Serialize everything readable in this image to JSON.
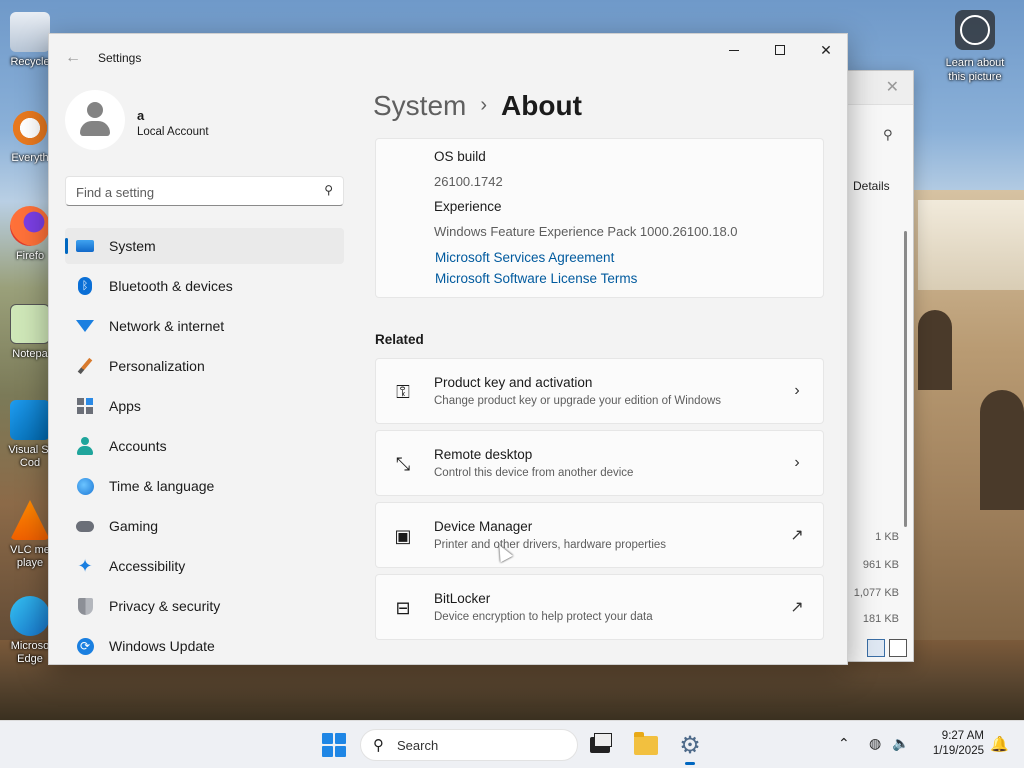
{
  "desktop": {
    "icons": [
      {
        "label": "Recycle"
      },
      {
        "label": "Everyth"
      },
      {
        "label": "Firefo"
      },
      {
        "label": "Notepa"
      },
      {
        "label": "Visual St Cod"
      },
      {
        "label": "VLC me playe"
      },
      {
        "label": "Microso Edge"
      }
    ],
    "learn_label": "Learn about this picture"
  },
  "background_window": {
    "details_label": "Details",
    "sizes": [
      "1 KB",
      "961 KB",
      "1,077 KB",
      "181 KB"
    ]
  },
  "settings": {
    "title": "Settings",
    "user": {
      "name": "a",
      "account_type": "Local Account"
    },
    "search_placeholder": "Find a setting",
    "nav": [
      {
        "label": "System",
        "icon": "monitor-icon",
        "active": true
      },
      {
        "label": "Bluetooth & devices",
        "icon": "bluetooth-icon"
      },
      {
        "label": "Network & internet",
        "icon": "wifi-icon"
      },
      {
        "label": "Personalization",
        "icon": "brush-icon"
      },
      {
        "label": "Apps",
        "icon": "apps-icon"
      },
      {
        "label": "Accounts",
        "icon": "person-icon"
      },
      {
        "label": "Time & language",
        "icon": "globe-clock-icon"
      },
      {
        "label": "Gaming",
        "icon": "gamepad-icon"
      },
      {
        "label": "Accessibility",
        "icon": "accessibility-icon"
      },
      {
        "label": "Privacy & security",
        "icon": "shield-icon"
      },
      {
        "label": "Windows Update",
        "icon": "update-icon"
      }
    ],
    "breadcrumb": {
      "parent": "System",
      "separator": "›",
      "current": "About"
    },
    "specs": {
      "os_build_label": "OS build",
      "os_build_value": "26100.1742",
      "experience_label": "Experience",
      "experience_value": "Windows Feature Experience Pack 1000.26100.18.0",
      "link1": "Microsoft Services Agreement",
      "link2": "Microsoft Software License Terms"
    },
    "related": {
      "title": "Related",
      "items": [
        {
          "title": "Product key and activation",
          "subtitle": "Change product key or upgrade your edition of Windows",
          "icon": "key-icon",
          "action": "chevron"
        },
        {
          "title": "Remote desktop",
          "subtitle": "Control this device from another device",
          "icon": "remote-desktop-icon",
          "action": "chevron"
        },
        {
          "title": "Device Manager",
          "subtitle": "Printer and other drivers, hardware properties",
          "icon": "device-manager-icon",
          "action": "external"
        },
        {
          "title": "BitLocker",
          "subtitle": "Device encryption to help protect your data",
          "icon": "bitlocker-icon",
          "action": "external"
        }
      ]
    }
  },
  "taskbar": {
    "search_label": "Search",
    "time": "9:27 AM",
    "date": "1/19/2025"
  },
  "colors": {
    "accent": "#0067c0",
    "link": "#005a9e",
    "window_bg": "#f3f3f3",
    "card_bg": "#fbfbfb"
  }
}
